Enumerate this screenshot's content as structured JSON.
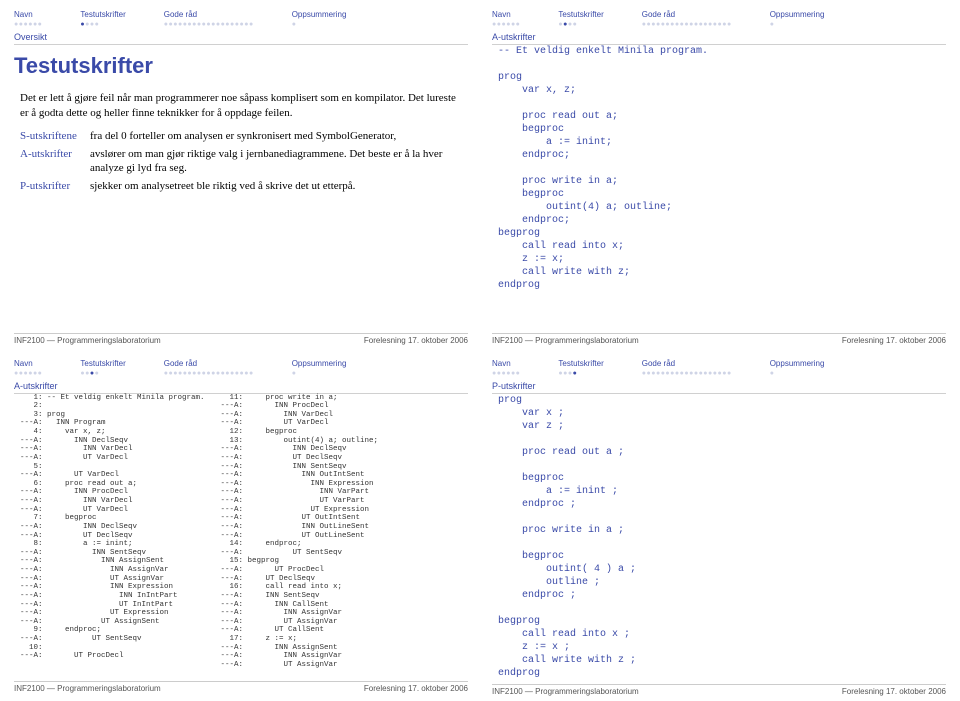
{
  "nav": {
    "items": [
      {
        "label": "Navn"
      },
      {
        "label": "Testutskrifter"
      },
      {
        "label": "Gode råd"
      },
      {
        "label": "Oppsummering"
      }
    ]
  },
  "footer": {
    "left": "INF2100 — Programmeringslaboratorium",
    "right": "Forelesning 17. oktober 2006"
  },
  "slide1": {
    "section": "Oversikt",
    "title": "Testutskrifter",
    "para": "Det er lett å gjøre feil når man programmerer noe såpass komplisert som en kompilator. Det lureste er å godta dette og heller finne teknikker for å oppdage feilen.",
    "defs": [
      {
        "term": "S-utskriftene",
        "desc": "fra del 0 forteller om analysen er synkronisert med SymbolGenerator,"
      },
      {
        "term": "A-utskrifter",
        "desc": "avslører om man gjør riktige valg i jernbanediagrammene. Det beste er å la hver analyze gi lyd fra seg."
      },
      {
        "term": "P-utskrifter",
        "desc": "sjekker om analysetreet ble riktig ved å skrive det ut etterpå."
      }
    ]
  },
  "slide2": {
    "section": "A-utskrifter",
    "code": "-- Et veldig enkelt Minila program.\n\nprog\n    var x, z;\n\n    proc read out a;\n    begproc\n        a := inint;\n    endproc;\n\n    proc write in a;\n    begproc\n        outint(4) a; outline;\n    endproc;\nbegprog\n    call read into x;\n    z := x;\n    call write with z;\nendprog"
  },
  "slide3": {
    "section": "A-utskrifter",
    "col1": "   1: -- Et veldig enkelt Minila program.\n   2:\n   3: prog\n---A:   INN Program\n   4:     var x, z;\n---A:       INN DeclSeqv\n---A:         INN VarDecl\n---A:         UT VarDecl\n   5:\n---A:       UT VarDecl\n   6:     proc read out a;\n---A:       INN ProcDecl\n---A:         INN VarDecl\n---A:         UT VarDecl\n   7:     begproc\n---A:         INN DeclSeqv\n---A:         UT DeclSeqv\n   8:         a := inint;\n---A:           INN SentSeqv\n---A:             INN AssignSent\n---A:               INN AssignVar\n---A:               UT AssignVar\n---A:               INN Expression\n---A:                 INN InIntPart\n---A:                 UT InIntPart\n---A:               UT Expression\n---A:             UT AssignSent\n   9:     endproc;\n---A:           UT SentSeqv\n  10:\n---A:       UT ProcDecl",
    "col2": "  11:     proc write in a;\n---A:       INN ProcDecl\n---A:         INN VarDecl\n---A:         UT VarDecl\n  12:     begproc\n  13:         outint(4) a; outline;\n---A:           INN DeclSeqv\n---A:           UT DeclSeqv\n---A:           INN SentSeqv\n---A:             INN OutIntSent\n---A:               INN Expression\n---A:                 INN VarPart\n---A:                 UT VarPart\n---A:               UT Expression\n---A:             UT OutIntSent\n---A:             INN OutLineSent\n---A:             UT OutLineSent\n  14:     endproc;\n---A:           UT SentSeqv\n  15: begprog\n---A:       UT ProcDecl\n---A:     UT DeclSeqv\n  16:     call read into x;\n---A:     INN SentSeqv\n---A:       INN CallSent\n---A:         INN AssignVar\n---A:         UT AssignVar\n---A:       UT CallSent\n  17:     z := x;\n---A:       INN AssignSent\n---A:         INN AssignVar\n---A:         UT AssignVar"
  },
  "slide4": {
    "section": "P-utskrifter",
    "code": "prog\n    var x ;\n    var z ;\n\n    proc read out a ;\n\n    begproc\n        a := inint ;\n    endproc ;\n\n    proc write in a ;\n\n    begproc\n        outint( 4 ) a ;\n        outline ;\n    endproc ;\n\nbegprog\n    call read into x ;\n    z := x ;\n    call write with z ;\nendprog"
  }
}
